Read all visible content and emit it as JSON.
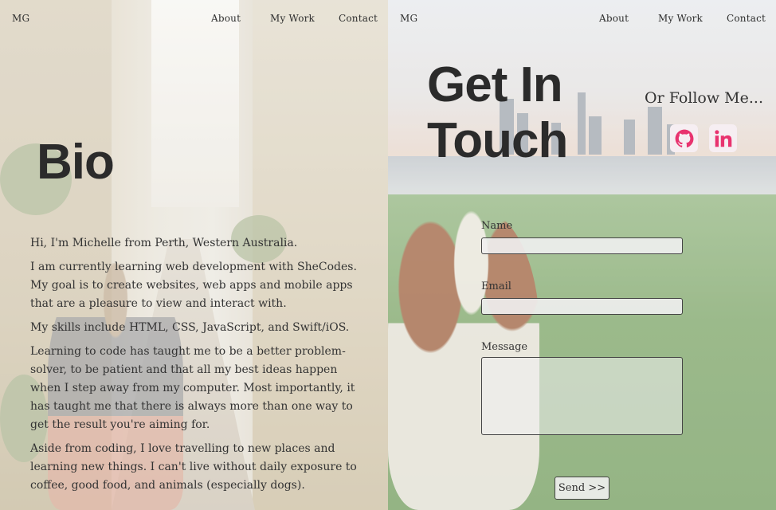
{
  "left_nav": {
    "logo": "MG",
    "links": [
      "About",
      "My Work",
      "Contact"
    ]
  },
  "right_nav": {
    "logo": "MG",
    "links": [
      "About",
      "My Work",
      "Contact"
    ]
  },
  "bio": {
    "title": "Bio",
    "paragraphs": [
      "Hi, I'm Michelle from Perth, Western Australia.",
      "I am currently learning web development with SheCodes. My goal is to create websites, web apps and mobile apps that are a pleasure to view and interact with.",
      "My skills include HTML, CSS, JavaScript, and Swift/iOS.",
      "Learning to code has taught me to be a better problem-solver, to be patient and that all my best ideas happen when I step away from my computer. Most importantly, it has taught me that there is always more than one way to get the result you're aiming for.",
      "Aside from coding, I love travelling to new places and learning new things. I can't live without daily exposure to coffee, good food, and animals (especially dogs)."
    ]
  },
  "contact": {
    "title_line1": "Get In",
    "title_line2": "Touch",
    "follow_text": "Or Follow Me...",
    "social": [
      {
        "name": "GitHub",
        "icon": "github-icon",
        "color": "#e8336f"
      },
      {
        "name": "LinkedIn",
        "icon": "linkedin-icon",
        "color": "#e8336f"
      }
    ],
    "form": {
      "name_label": "Name",
      "email_label": "Email",
      "message_label": "Message",
      "name_value": "",
      "email_value": "",
      "message_value": "",
      "submit_label": "Send >>"
    }
  },
  "colors": {
    "heading": "#2b2b2b",
    "body_text": "#333333",
    "social_accent": "#e8336f"
  }
}
